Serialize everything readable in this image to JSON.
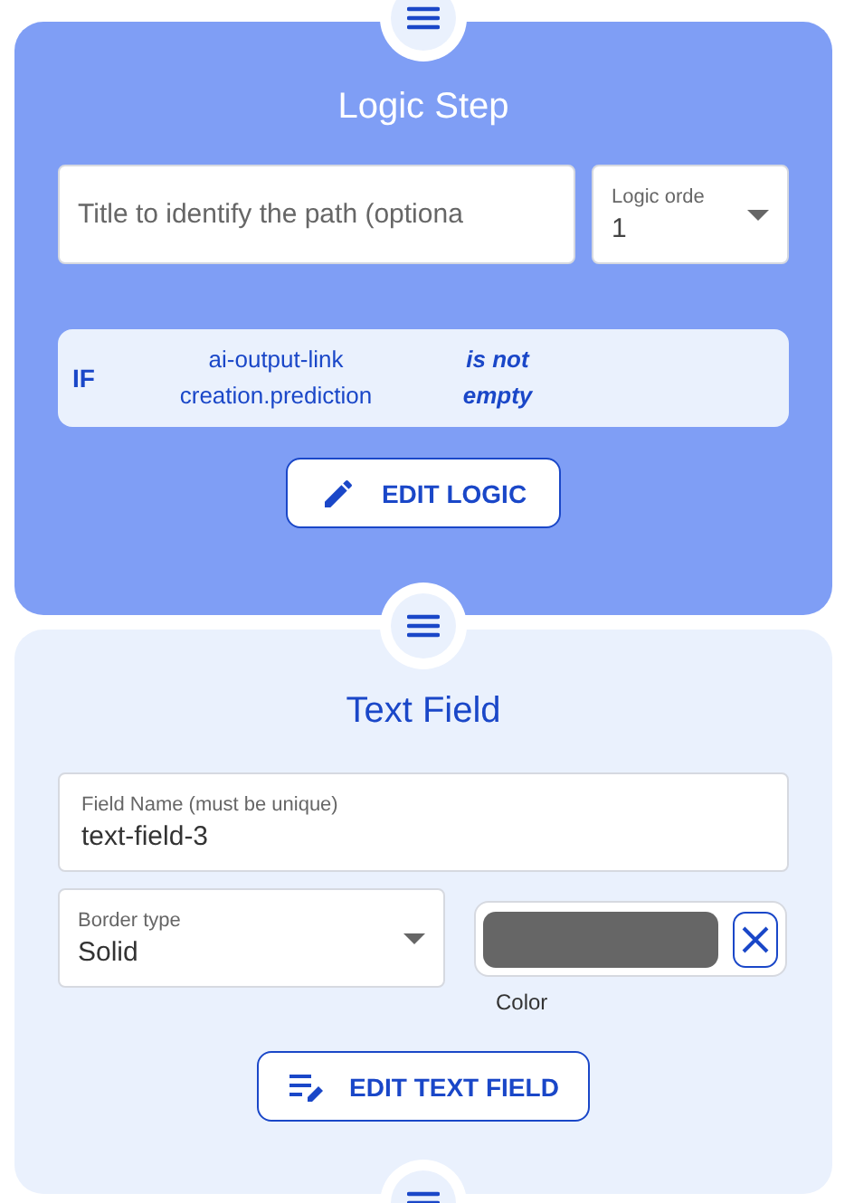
{
  "logic_step": {
    "title": "Logic Step",
    "title_field": {
      "placeholder": "Title to identify the path (optiona"
    },
    "order_select": {
      "label": "Logic orde",
      "value": "1"
    },
    "condition": {
      "keyword": "IF",
      "field": "ai-output-link\ncreation.prediction",
      "operator": "is not\nempty"
    },
    "button": "EDIT LOGIC"
  },
  "text_field_step": {
    "title": "Text Field",
    "name_field": {
      "label": "Field Name (must be unique)",
      "value": "text-field-3"
    },
    "border_select": {
      "label": "Border type",
      "value": "Solid"
    },
    "color_picker": {
      "color": "#666666",
      "label": "Color"
    },
    "button": "EDIT TEXT FIELD"
  }
}
